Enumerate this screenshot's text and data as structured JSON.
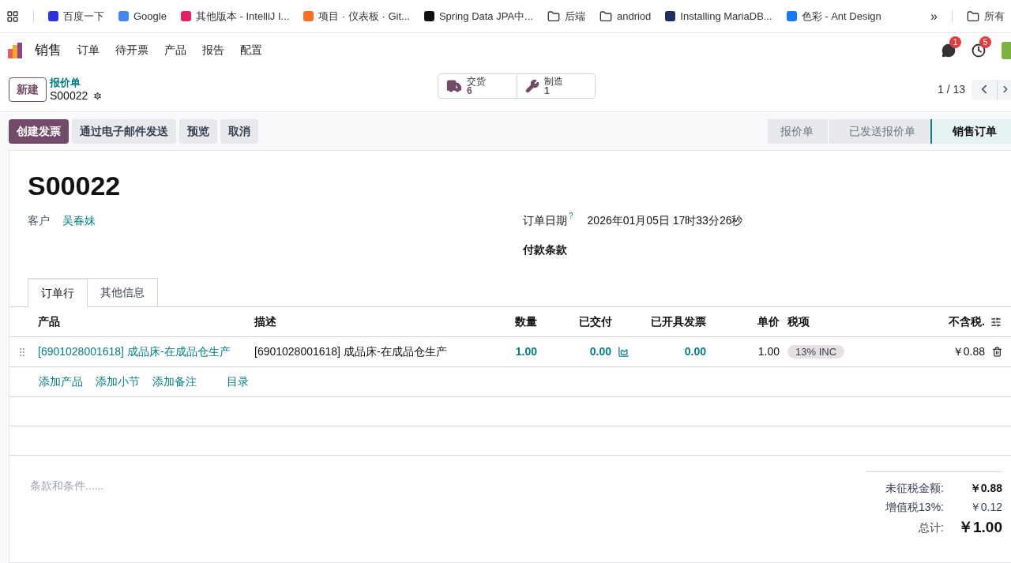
{
  "bookmarks": [
    {
      "label": "百度一下",
      "kind": "favicon",
      "color": "#2932e1"
    },
    {
      "label": "Google",
      "kind": "favicon",
      "color": "#4285f4"
    },
    {
      "label": "其他版本 - IntelliJ I...",
      "kind": "favicon",
      "color": "#e91e63"
    },
    {
      "label": "项目 · 仪表板 · Git...",
      "kind": "favicon",
      "color": "#fc6d26"
    },
    {
      "label": "Spring Data JPA中...",
      "kind": "favicon",
      "color": "#111111"
    },
    {
      "label": "后端",
      "kind": "folder"
    },
    {
      "label": "andriod",
      "kind": "folder"
    },
    {
      "label": "Installing MariaDB...",
      "kind": "favicon",
      "color": "#1f305f"
    },
    {
      "label": "色彩 - Ant Design",
      "kind": "favicon",
      "color": "#1677ff"
    }
  ],
  "bookmarks_overflow": "»",
  "bookmarks_other": "所有",
  "nav": {
    "app": "销售",
    "menu": [
      "订单",
      "待开票",
      "产品",
      "报告",
      "配置"
    ],
    "message_count": "1",
    "activity_count": "5"
  },
  "control": {
    "new_button": "新建",
    "parent": "报价单",
    "record": "S00022",
    "smart_buttons": [
      {
        "kind": "truck",
        "label": "交货",
        "value": "6"
      },
      {
        "kind": "wrench",
        "label": "制造",
        "value": "1"
      }
    ],
    "pager": "1 / 13"
  },
  "actions": [
    {
      "label": "创建发票",
      "primary": true
    },
    {
      "label": "通过电子邮件发送",
      "primary": false
    },
    {
      "label": "预览",
      "primary": false
    },
    {
      "label": "取消",
      "primary": false
    }
  ],
  "status_steps": [
    {
      "label": "报价单",
      "selected": false
    },
    {
      "label": "已发送报价单",
      "selected": false
    },
    {
      "label": "销售订单",
      "selected": true
    }
  ],
  "form": {
    "title": "S00022",
    "customer_label": "客户",
    "customer": "吴春妹",
    "date_label": "订单日期",
    "date_help": "?",
    "date": "2026年01月05日 17时33分26秒",
    "terms_label": "付款条款"
  },
  "tabs": [
    {
      "label": "订单行",
      "selected": true
    },
    {
      "label": "其他信息",
      "selected": false
    }
  ],
  "table": {
    "columns": [
      "产品",
      "描述",
      "数量",
      "已交付",
      "已开具发票",
      "单价",
      "税项",
      "不含税."
    ],
    "rows": [
      {
        "product": "[6901028001618] 成品床-在成品仓生产",
        "description": "[6901028001618] 成品床-在成品仓生产",
        "quantity": "1.00",
        "delivered": "0.00",
        "invoiced": "0.00",
        "price": "1.00",
        "tax": "13% INC",
        "subtotal": "￥0.88"
      }
    ],
    "add_links": [
      "添加产品",
      "添加小节",
      "添加备注",
      "目录"
    ]
  },
  "terms_placeholder": "条款和条件......",
  "totals": [
    {
      "label": "未征税金额:",
      "value": "￥0.88",
      "bold": true
    },
    {
      "label": "增值税13%:",
      "value": "￥0.12",
      "bold": false
    },
    {
      "label": "总计:",
      "value": "￥1.00",
      "bold": true
    }
  ]
}
